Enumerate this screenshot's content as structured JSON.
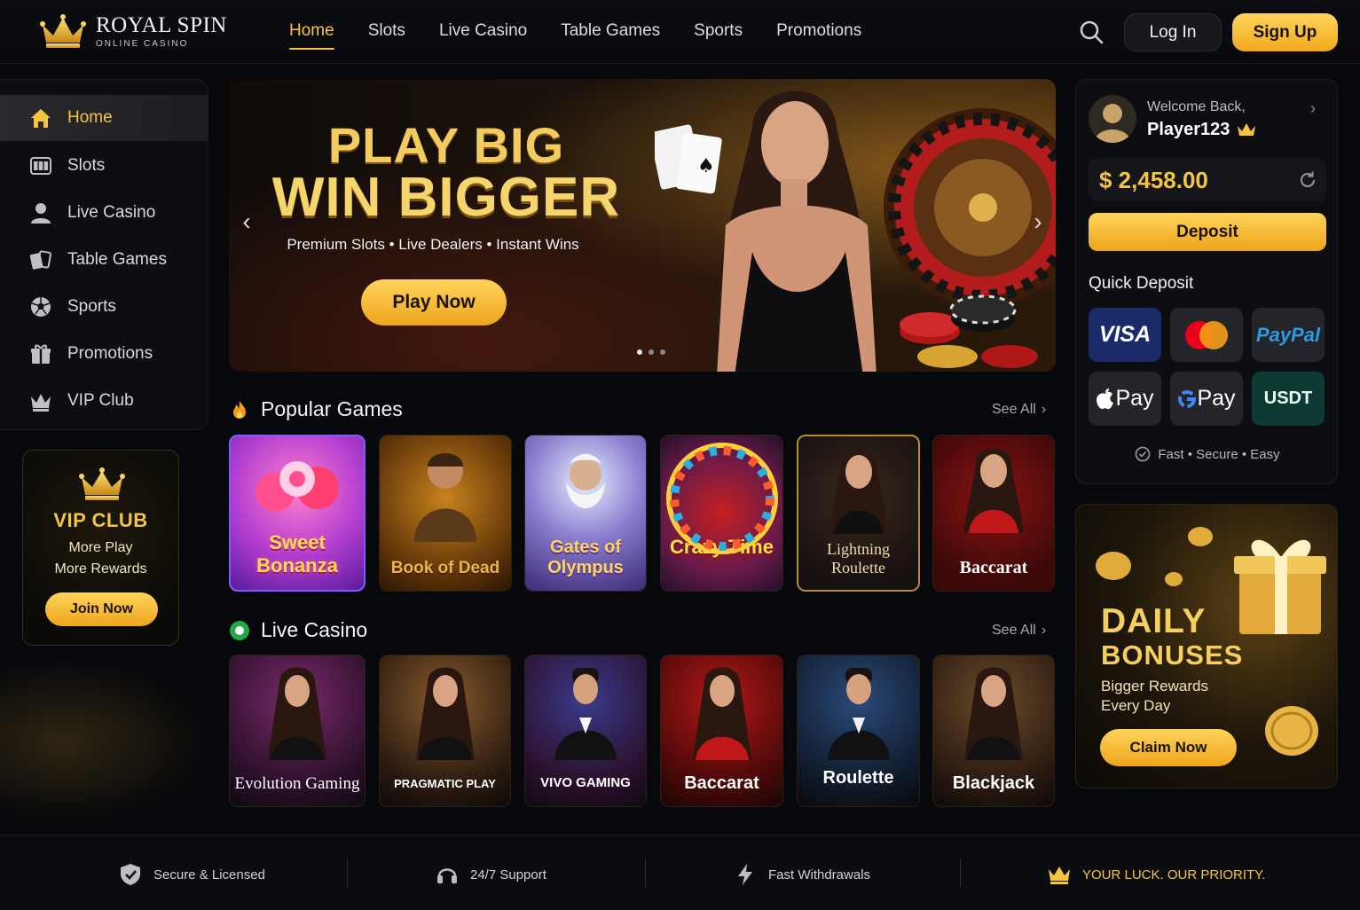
{
  "brand": {
    "name": "ROYAL SPIN",
    "tagline": "ONLINE CASINO"
  },
  "nav": {
    "items": [
      "Home",
      "Slots",
      "Live Casino",
      "Table Games",
      "Sports",
      "Promotions"
    ],
    "active": "Home",
    "login_label": "Log In",
    "signup_label": "Sign Up"
  },
  "sidebar": {
    "items": [
      {
        "label": "Home",
        "icon": "home-icon"
      },
      {
        "label": "Slots",
        "icon": "slot-machine-icon"
      },
      {
        "label": "Live Casino",
        "icon": "dealer-icon"
      },
      {
        "label": "Table Games",
        "icon": "cards-icon"
      },
      {
        "label": "Sports",
        "icon": "soccer-ball-icon"
      },
      {
        "label": "Promotions",
        "icon": "gift-icon"
      },
      {
        "label": "VIP Club",
        "icon": "crown-icon"
      }
    ],
    "vip": {
      "title": "VIP CLUB",
      "line1": "More Play",
      "line2": "More Rewards",
      "button": "Join Now"
    }
  },
  "hero": {
    "title1": "PLAY BIG",
    "title2": "WIN BIGGER",
    "subtitle": "Premium Slots • Live Dealers • Instant Wins",
    "button": "Play Now"
  },
  "popular": {
    "title": "Popular Games",
    "see_all": "See All",
    "games": [
      "Sweet Bonanza",
      "Book of Dead",
      "Gates of Olympus",
      "Crazy Time",
      "Lightning Roulette",
      "Baccarat"
    ]
  },
  "live": {
    "title": "Live Casino",
    "see_all": "See All",
    "tables": [
      "Evolution Gaming",
      "PRAGMATIC PLAY",
      "VIVO GAMING",
      "Baccarat",
      "Roulette",
      "Blackjack"
    ]
  },
  "wallet": {
    "welcome": "Welcome Back,",
    "player": "Player123",
    "balance": "$ 2,458.00",
    "deposit": "Deposit",
    "quick_deposit": "Quick Deposit",
    "methods": [
      "VISA",
      "Mastercard",
      "PayPal",
      "Pay",
      "Pay",
      "USDT"
    ],
    "note": "Fast • Secure • Easy"
  },
  "bonus": {
    "title1": "DAILY",
    "title2": "BONUSES",
    "sub1": "Bigger Rewards",
    "sub2": "Every Day",
    "button": "Claim Now"
  },
  "footer": {
    "items": [
      "Secure & Licensed",
      "24/7 Support",
      "Fast Withdrawals",
      "YOUR LUCK. OUR PRIORITY."
    ]
  },
  "colors": {
    "accent": "#f5c542",
    "background": "#07080b",
    "panel": "#0d0e12"
  }
}
